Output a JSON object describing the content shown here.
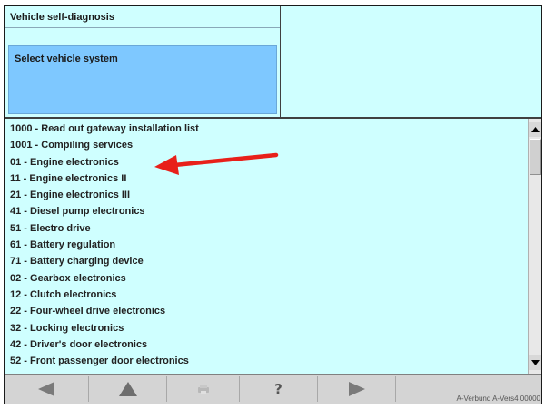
{
  "header": {
    "title": "Vehicle self-diagnosis",
    "subtitle": "Select vehicle system"
  },
  "systems": [
    "1000 - Read out gateway installation list",
    "1001 - Compiling services",
    "01 - Engine electronics",
    "11 - Engine electronics II",
    "21 - Engine electronics III",
    "41 - Diesel pump electronics",
    "51 - Electro drive",
    "61 - Battery regulation",
    "71 - Battery charging device",
    "02 - Gearbox electronics",
    "12 - Clutch electronics",
    "22 - Four-wheel drive electronics",
    "32 - Locking electronics",
    "42 - Driver's door electronics",
    "52 - Front passenger door electronics"
  ],
  "toolbar": {
    "back_icon": "triangle-left-icon",
    "up_icon": "triangle-up-icon",
    "print_icon": "print-icon",
    "help_glyph": "?",
    "forward_icon": "triangle-right-icon"
  },
  "status": {
    "text": "A-Verbund  A-Vers4  00000"
  },
  "annotation": {
    "arrow_color": "#e8201a",
    "points_to": "01 - Engine electronics"
  },
  "colors": {
    "panel_bg": "#cfffff",
    "selected_panel_bg": "#7ec8ff",
    "toolbar_bg": "#d4d4d4",
    "icon_gray": "#808080"
  }
}
